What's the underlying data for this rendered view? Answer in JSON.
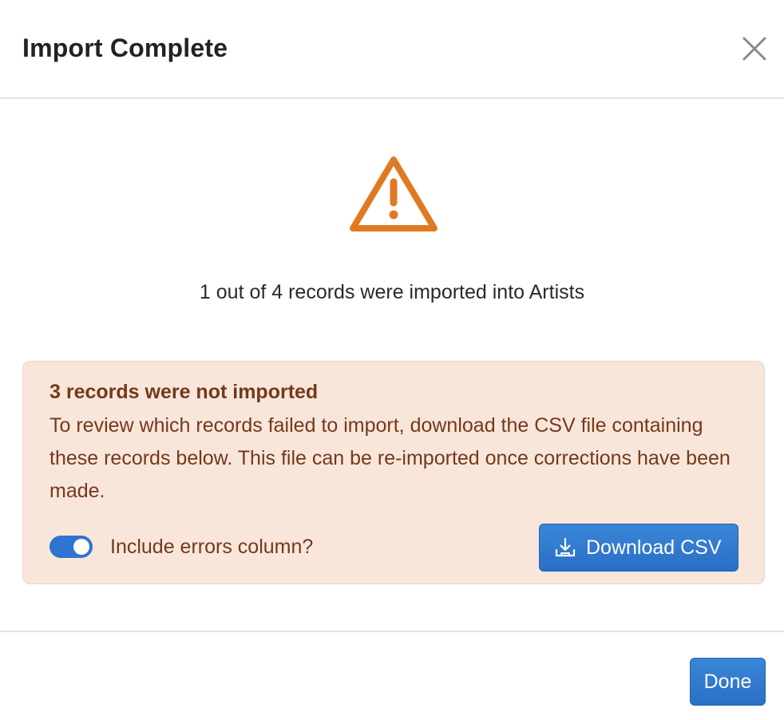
{
  "dialog": {
    "title": "Import Complete"
  },
  "summary": {
    "text": "1 out of 4 records were imported into Artists"
  },
  "notice": {
    "title": "3 records were not imported",
    "text": "To review which records failed to import, download the CSV file containing these records below. This file can be re-imported once corrections have been made.",
    "toggle_label": "Include errors column?",
    "toggle_on": true,
    "download_label": "Download CSV"
  },
  "footer": {
    "done_label": "Done"
  },
  "icons": {
    "close": "close-icon",
    "warning": "warning-icon",
    "download": "download-icon"
  },
  "colors": {
    "accent": "#2f74d0",
    "warning": "#e07a22",
    "notice_bg": "#f8e6db",
    "notice_text": "#74391a"
  }
}
